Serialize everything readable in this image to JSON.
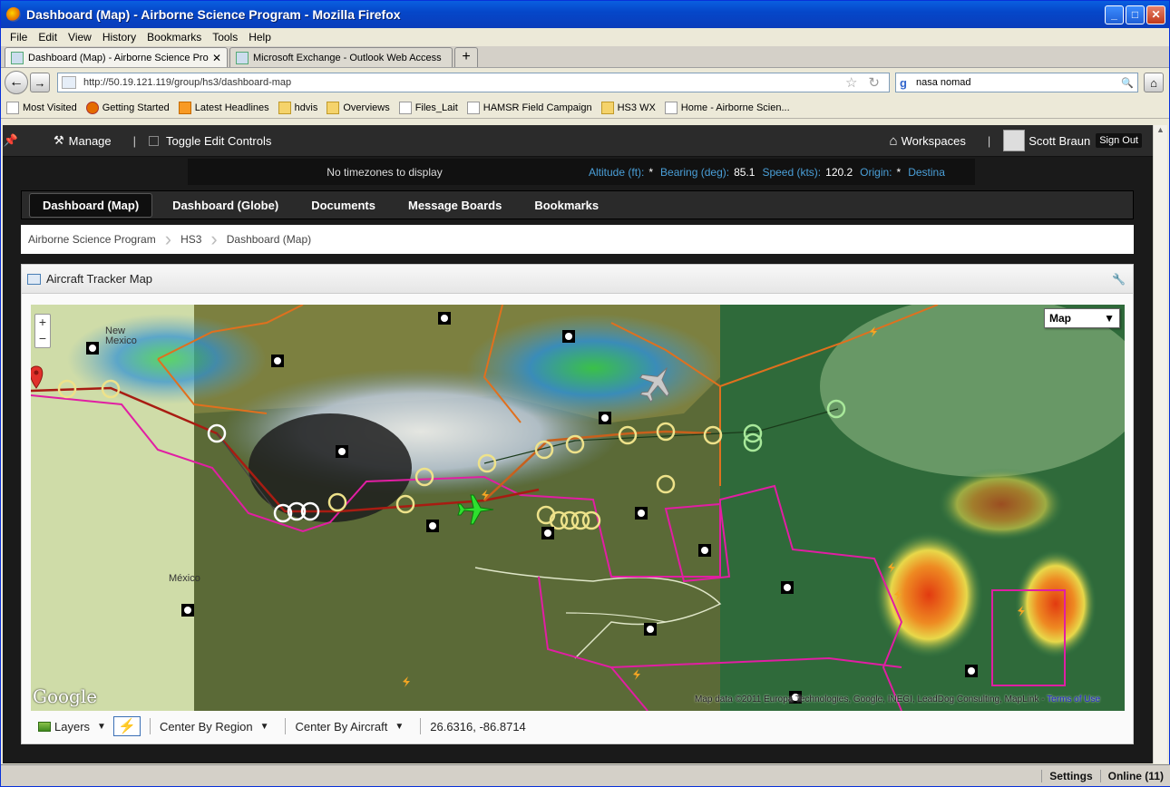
{
  "window": {
    "title": "Dashboard (Map) - Airborne Science Program - Mozilla Firefox",
    "controls": {
      "minimize": "_",
      "maximize": "□",
      "close": "✕"
    }
  },
  "menu": [
    "File",
    "Edit",
    "View",
    "History",
    "Bookmarks",
    "Tools",
    "Help"
  ],
  "tabs": [
    {
      "label": "Dashboard (Map) - Airborne Science Prog...",
      "active": true,
      "close": "✕"
    },
    {
      "label": "Microsoft Exchange - Outlook Web Access",
      "active": false
    }
  ],
  "new_tab_label": "+",
  "nav": {
    "back": "←",
    "forward": "→",
    "url": "http://50.19.121.119/group/hs3/dashboard-map",
    "star": "☆",
    "reload": "↻",
    "search_engine": "g",
    "search_value": "nasa nomad",
    "home": "⌂"
  },
  "bookmarks": [
    {
      "label": "Most Visited",
      "icon": "page-icon"
    },
    {
      "label": "Getting Started",
      "icon": "firefox-icon"
    },
    {
      "label": "Latest Headlines",
      "icon": "rss-icon"
    },
    {
      "label": "hdvis",
      "icon": "folder-icon"
    },
    {
      "label": "Overviews",
      "icon": "folder-icon"
    },
    {
      "label": "Files_Lait",
      "icon": "page-icon"
    },
    {
      "label": "HAMSR Field Campaign",
      "icon": "page-icon"
    },
    {
      "label": "HS3 WX",
      "icon": "folder-icon"
    },
    {
      "label": "Home - Airborne Scien...",
      "icon": "page-icon"
    }
  ],
  "topbar": {
    "pin": "📌",
    "manage": "Manage",
    "toggle_edit": "Toggle Edit Controls",
    "workspaces": "Workspaces",
    "sep": "|",
    "user": "Scott Braun",
    "signout": "Sign Out"
  },
  "status": {
    "timezones": "No timezones to display",
    "altitude_label": "Altitude (ft):",
    "altitude_value": "*",
    "bearing_label": "Bearing (deg):",
    "bearing_value": "85.1",
    "speed_label": "Speed (kts):",
    "speed_value": "120.2",
    "origin_label": "Origin:",
    "origin_value": "*",
    "destination_label": "Destina"
  },
  "navtabs": [
    "Dashboard (Map)",
    "Dashboard (Globe)",
    "Documents",
    "Message Boards",
    "Bookmarks"
  ],
  "breadcrumb": [
    "Airborne Science Program",
    "HS3",
    "Dashboard (Map)"
  ],
  "portlet": {
    "title": "Aircraft Tracker Map",
    "wrench": "🔧"
  },
  "map": {
    "zoom_in": "+",
    "zoom_out": "−",
    "maptype": "Map",
    "maptype_caret": "▼",
    "google": "Google",
    "attribution": "Map data ©2011 Europa Technologies, Google, INEGI, LeadDog Consulting, MapLink - ",
    "terms": "Terms of Use",
    "labels": {
      "new_mexico": "New\nMexico",
      "mexico": "México"
    }
  },
  "maptoolbar": {
    "layers": "Layers",
    "bolt": "⚡",
    "center_region": "Center By Region",
    "center_aircraft": "Center By Aircraft",
    "coords": "26.6316, -86.8714",
    "caret": "▼"
  },
  "bottom": {
    "settings": "Settings",
    "online": "Online (11)"
  }
}
